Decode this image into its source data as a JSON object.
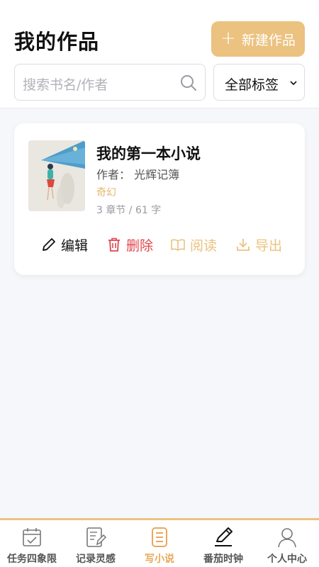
{
  "header": {
    "title": "我的作品",
    "new_button": {
      "plus": "+",
      "label": "新建作品"
    },
    "search": {
      "placeholder": "搜索书名/作者"
    },
    "tag_filter": {
      "selected": "全部标签"
    }
  },
  "books": [
    {
      "title": "我的第一本小说",
      "author_label": "作者：",
      "author": "光辉记簿",
      "genre": "奇幻",
      "stats": "3 章节 / 61 字",
      "actions": {
        "edit": "编辑",
        "delete": "删除",
        "read": "阅读",
        "export": "导出"
      }
    }
  ],
  "tabbar": {
    "items": [
      {
        "label": "任务四象限",
        "icon": "calendar-check-icon",
        "active": false
      },
      {
        "label": "记录灵感",
        "icon": "notebook-pen-icon",
        "active": false
      },
      {
        "label": "写小说",
        "icon": "book-icon",
        "active": true
      },
      {
        "label": "番茄时钟",
        "icon": "pencil-icon",
        "active": false
      },
      {
        "label": "个人中心",
        "icon": "person-icon",
        "active": false
      }
    ]
  },
  "colors": {
    "accent": "#ebc27f",
    "active_tab": "#e8a95c",
    "danger": "#e0474c"
  }
}
